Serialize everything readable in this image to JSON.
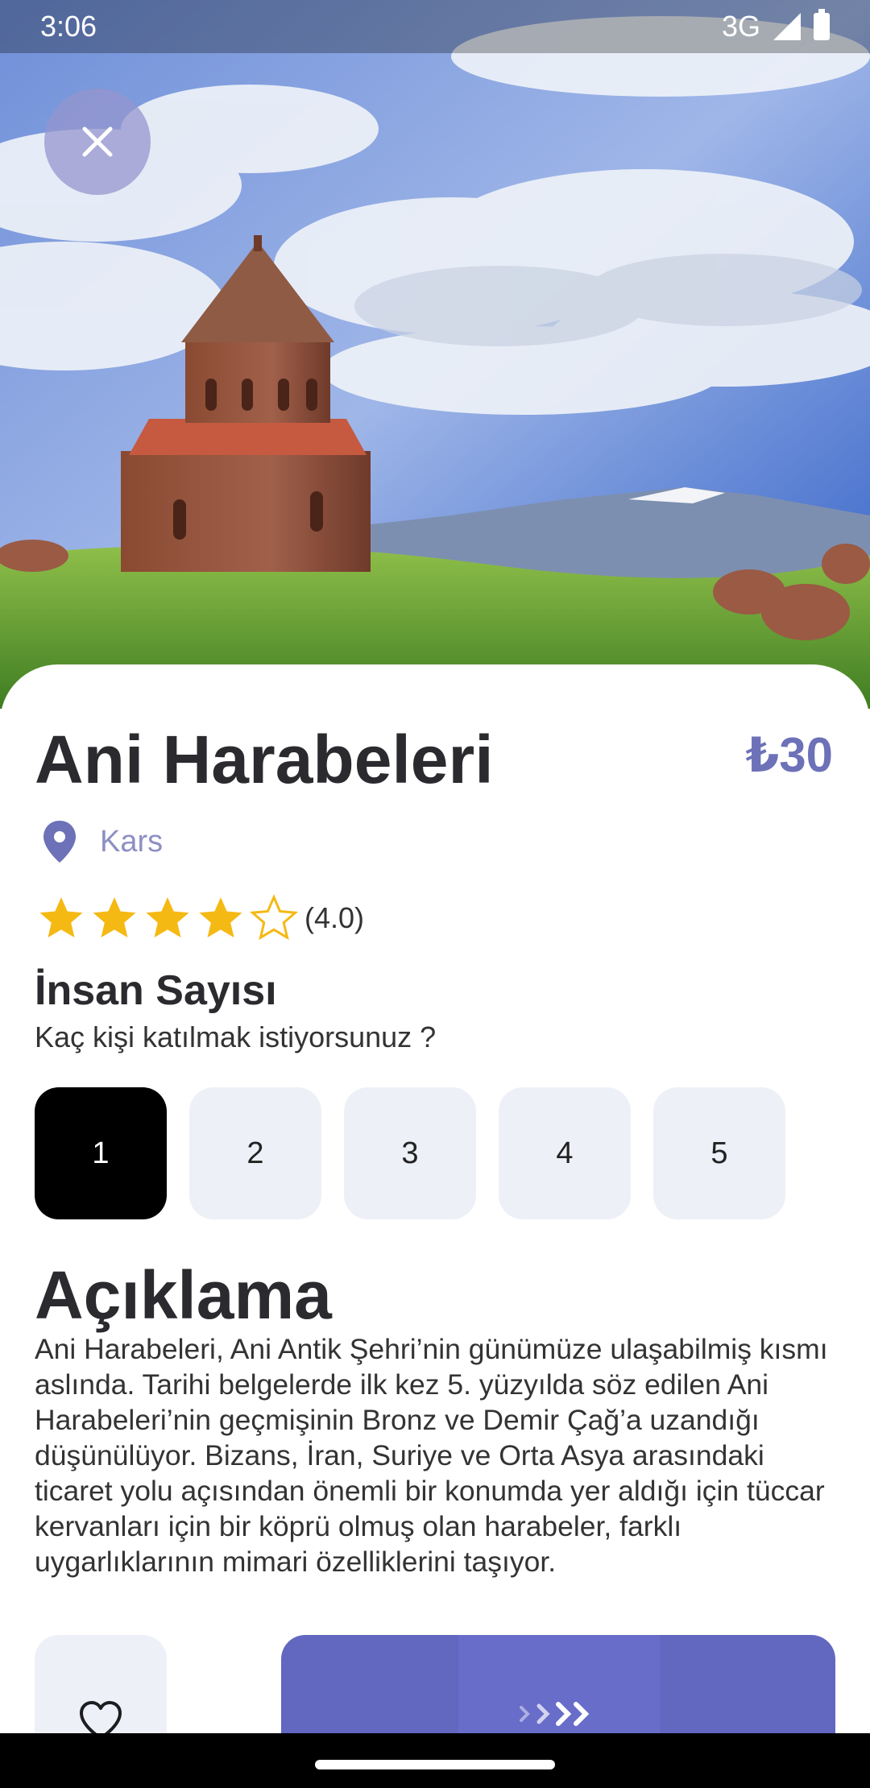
{
  "status_bar": {
    "time": "3:06",
    "network": "3G"
  },
  "hero": {
    "alt": "Ani Harabeleri"
  },
  "place": {
    "title": "Ani Harabeleri",
    "price": "₺30",
    "location": "Kars",
    "rating_value": 4.0,
    "rating_max": 5,
    "rating_text": "(4.0)"
  },
  "people": {
    "title": "İnsan Sayısı",
    "subtitle": "Kaç kişi katılmak istiyorsunuz ?",
    "options": [
      "1",
      "2",
      "3",
      "4",
      "5"
    ],
    "selected": "1"
  },
  "description": {
    "title": "Açıklama",
    "text": "Ani Harabeleri, Ani Antik Şehri’nin günümüze ulaşabilmiş kısmı aslında. Tarihi belgelerde ilk kez 5. yüzyılda söz edilen Ani Harabeleri’nin geçmişinin Bronz ve Demir Çağ’a uzandığı düşünülüyor. Bizans, İran, Suriye ve Orta Asya arasındaki ticaret yolu açısından önemli bir konumda yer aldığı için tüccar kervanları için bir köprü olmuş olan harabeler, farklı uygarlıklarının mimari özelliklerini taşıyor."
  },
  "colors": {
    "accent": "#6d71b8",
    "button": "#6267bf",
    "chip_bg": "#eef0f8",
    "chip_active": "#000000"
  },
  "icons": {
    "close": "close-icon",
    "location": "location-pin-icon",
    "favorite": "heart-icon",
    "proceed": "arrows-right-icon"
  }
}
